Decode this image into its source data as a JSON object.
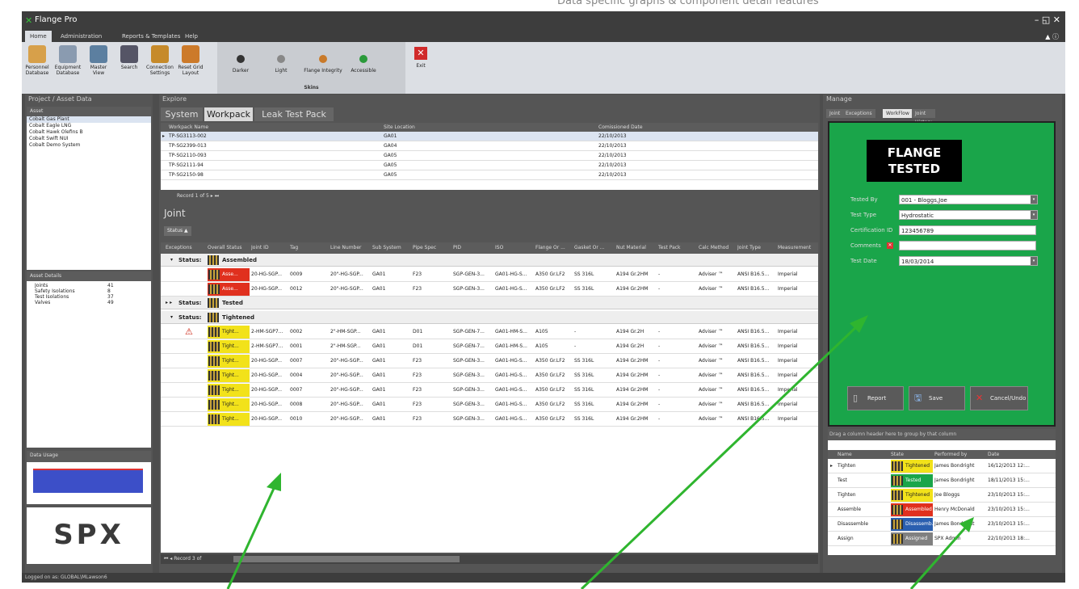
{
  "top_caption": "Data specific graphs & component detail features",
  "window": {
    "title": "Flange Pro",
    "controls": "– ◱ ✕",
    "help": "▲ ⓘ"
  },
  "ribbon_tabs": [
    "Home",
    "Administration",
    "Reports & Templates",
    "Help"
  ],
  "ribbon_buttons": [
    {
      "label": "Personnel Database",
      "icon": "person-icon"
    },
    {
      "label": "Equipment Database",
      "icon": "gear-icon"
    },
    {
      "label": "Master View",
      "icon": "monitor-icon"
    },
    {
      "label": "Search",
      "icon": "binoculars-icon"
    },
    {
      "label": "Connection Settings",
      "icon": "connection-icon"
    },
    {
      "label": "Reset Grid Layout",
      "icon": "reset-icon"
    }
  ],
  "skins": {
    "label": "Skins",
    "items": [
      {
        "name": "Darker",
        "color": "#333333"
      },
      {
        "name": "Light",
        "color": "#888888"
      },
      {
        "name": "Flange Integrity",
        "color": "#c97a2a"
      },
      {
        "name": "Accessible",
        "color": "#2a9a3a"
      }
    ]
  },
  "exit_label": "Exit",
  "left": {
    "title": "Project / Asset Data",
    "pin": "ᵖ",
    "asset_header": "Asset",
    "assets": [
      "Cobalt Gas Plant",
      "Cobalt Eagle LNG",
      "Cobalt Hawk Olefins B",
      "Cobalt Swift NUI",
      "Cobalt Demo System"
    ],
    "details_header": "Asset Details",
    "details": [
      {
        "k": "Joints",
        "v": "41"
      },
      {
        "k": "Safety Isolations",
        "v": "8"
      },
      {
        "k": "Test Isolations",
        "v": "37"
      },
      {
        "k": "Valves",
        "v": "49"
      }
    ],
    "usage_header": "Data Usage",
    "logo": "SPX"
  },
  "explore": {
    "title": "Explore",
    "tabs": [
      "System",
      "Workpack",
      "Leak Test Pack"
    ],
    "wp_columns": [
      "Workpack Name",
      "Site Location",
      "Comissioned Date"
    ],
    "workpacks": [
      [
        "TP-SG3113-002",
        "GA01",
        "22/10/2013"
      ],
      [
        "TP-SG2399-013",
        "GA04",
        "22/10/2013"
      ],
      [
        "TP-SG2110-093",
        "GA05",
        "22/10/2013"
      ],
      [
        "TP-SG2111-94",
        "GA05",
        "22/10/2013"
      ],
      [
        "TP-SG2150-98",
        "GA05",
        "22/10/2013"
      ]
    ],
    "wp_nav": "Record 1 of 5",
    "joint_title": "Joint",
    "status_chip": "Status ▲",
    "joint_columns": [
      "Exceptions",
      "Overall Status",
      "Joint ID",
      "Tag",
      "Line Number",
      "Sub System",
      "Pipe Spec",
      "PID",
      "ISO",
      "Flange Or ...",
      "Gasket Or ...",
      "Nut Material",
      "Test Pack",
      "Calc Method",
      "Joint Type",
      "Measurement"
    ],
    "group_prefix": "Status:",
    "groups": [
      {
        "name": "Assembled",
        "rows": [
          [
            "",
            "Asse...",
            "20-HG-SGP...",
            "0009",
            "20\"-HG-SGP...",
            "GA01",
            "F23",
            "SGP-GEN-3...",
            "GA01-HG-S...",
            "A350 Gr.LF2",
            "SS 316L",
            "A194 Gr.2HM",
            "-",
            "Adviser ™",
            "ANSI B16.5...",
            "Imperial"
          ],
          [
            "",
            "Asse...",
            "20-HG-SGP...",
            "0012",
            "20\"-HG-SGP...",
            "GA01",
            "F23",
            "SGP-GEN-3...",
            "GA01-HG-S...",
            "A350 Gr.LF2",
            "SS 316L",
            "A194 Gr.2HM",
            "-",
            "Adviser ™",
            "ANSI B16.5...",
            "Imperial"
          ]
        ]
      },
      {
        "name": "Tested",
        "rows": []
      },
      {
        "name": "Tightened",
        "rows": [
          [
            "⚠",
            "Tight...",
            "2-HM-SGP7...",
            "0002",
            "2\"-HM-SGP...",
            "GA01",
            "D01",
            "SGP-GEN-7...",
            "GA01-HM-S...",
            "A105",
            "-",
            "A194 Gr.2H",
            "-",
            "Adviser ™",
            "ANSI B16.5...",
            "Imperial"
          ],
          [
            "",
            "Tight...",
            "2-HM-SGP7...",
            "0001",
            "2\"-HM-SGP...",
            "GA01",
            "D01",
            "SGP-GEN-7...",
            "GA01-HM-S...",
            "A105",
            "-",
            "A194 Gr.2H",
            "-",
            "Adviser ™",
            "ANSI B16.5...",
            "Imperial"
          ],
          [
            "",
            "Tight...",
            "20-HG-SGP...",
            "0007",
            "20\"-HG-SGP...",
            "GA01",
            "F23",
            "SGP-GEN-3...",
            "GA01-HG-S...",
            "A350 Gr.LF2",
            "SS 316L",
            "A194 Gr.2HM",
            "-",
            "Adviser ™",
            "ANSI B16.5...",
            "Imperial"
          ],
          [
            "",
            "Tight...",
            "20-HG-SGP...",
            "0004",
            "20\"-HG-SGP...",
            "GA01",
            "F23",
            "SGP-GEN-3...",
            "GA01-HG-S...",
            "A350 Gr.LF2",
            "SS 316L",
            "A194 Gr.2HM",
            "-",
            "Adviser ™",
            "ANSI B16.5...",
            "Imperial"
          ],
          [
            "",
            "Tight...",
            "20-HG-SGP...",
            "0007",
            "20\"-HG-SGP...",
            "GA01",
            "F23",
            "SGP-GEN-3...",
            "GA01-HG-S...",
            "A350 Gr.LF2",
            "SS 316L",
            "A194 Gr.2HM",
            "-",
            "Adviser ™",
            "ANSI B16.5...",
            "Imperial"
          ],
          [
            "",
            "Tight...",
            "20-HG-SGP...",
            "0008",
            "20\"-HG-SGP...",
            "GA01",
            "F23",
            "SGP-GEN-3...",
            "GA01-HG-S...",
            "A350 Gr.LF2",
            "SS 316L",
            "A194 Gr.2HM",
            "-",
            "Adviser ™",
            "ANSI B16.5...",
            "Imperial"
          ],
          [
            "",
            "Tight...",
            "20-HG-SGP...",
            "0010",
            "20\"-HG-SGP...",
            "GA01",
            "F23",
            "SGP-GEN-3...",
            "GA01-HG-S...",
            "A350 Gr.LF2",
            "SS 316L",
            "A194 Gr.2HM",
            "-",
            "Adviser ™",
            "ANSI B16.5...",
            "Imperial"
          ]
        ]
      }
    ],
    "joint_nav": "Record 3 of"
  },
  "manage": {
    "title": "Manage",
    "tabs": [
      "Joint",
      "Exceptions",
      "WorkFlow",
      "Joint History"
    ],
    "banner": "FLANGE TESTED",
    "fields": [
      {
        "label": "Tested By",
        "value": "001 - Bloggs,Joe",
        "drop": true
      },
      {
        "label": "Test Type",
        "value": "Hydrostatic",
        "drop": true
      },
      {
        "label": "Certification ID",
        "value": "123456789",
        "drop": false
      },
      {
        "label": "Comments",
        "value": "",
        "drop": false
      },
      {
        "label": "Test Date",
        "value": "18/03/2014",
        "drop": true
      }
    ],
    "buttons": [
      "Report",
      "Save",
      "Cancel/Undo"
    ],
    "group_hint": "Drag a column header here to group by that column",
    "hist_columns": [
      "Name",
      "State",
      "Performed by",
      "Date"
    ],
    "history": [
      {
        "name": "Tighten",
        "state": "Tightened",
        "color": "#f2e21a",
        "by": "James Bondright",
        "date": "16/12/2013 12:..."
      },
      {
        "name": "Test",
        "state": "Tested",
        "color": "#1aa54a",
        "by": "James Bondright",
        "date": "18/11/2013 15:..."
      },
      {
        "name": "Tighten",
        "state": "Tightened",
        "color": "#f2e21a",
        "by": "Joe Bloggs",
        "date": "23/10/2013 15:..."
      },
      {
        "name": "Assemble",
        "state": "Assembled",
        "color": "#e0301e",
        "by": "Henry McDonald",
        "date": "23/10/2013 15:..."
      },
      {
        "name": "Disassemble",
        "state": "Disassemb...",
        "color": "#2a5fb0",
        "by": "James Bondright",
        "date": "23/10/2013 15:..."
      },
      {
        "name": "Assign",
        "state": "Assigned",
        "color": "#808080",
        "by": "SPX Admin",
        "date": "22/10/2013 18:..."
      }
    ]
  },
  "statusbar": "Logged on as: GLOBAL\\MLawson6",
  "colors": {
    "assembled": "#e0301e",
    "tightened": "#f2e21a",
    "tested": "#1aa54a",
    "panel_green": "#1aa54a",
    "arrow": "#2fb52f"
  }
}
